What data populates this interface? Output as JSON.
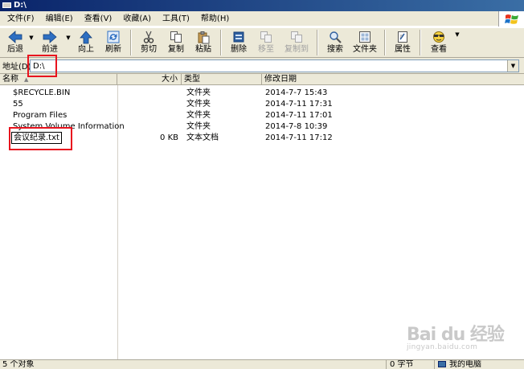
{
  "window": {
    "title": "D:\\"
  },
  "menu": [
    "文件(F)",
    "编辑(E)",
    "查看(V)",
    "收藏(A)",
    "工具(T)",
    "帮助(H)"
  ],
  "toolbar": {
    "back": "后退",
    "forward": "前进",
    "up": "向上",
    "refresh": "刷新",
    "cut": "剪切",
    "copy": "复制",
    "paste": "粘贴",
    "delete": "删除",
    "move_to": "移至",
    "copy_to": "复制到",
    "search": "搜索",
    "folders": "文件夹",
    "properties": "属性",
    "view": "查看"
  },
  "address": {
    "label": "地址(D)",
    "value": "D:\\"
  },
  "columns": {
    "name": "名称",
    "size": "大小",
    "type": "类型",
    "modified": "修改日期"
  },
  "files": [
    {
      "name": "$RECYCLE.BIN",
      "size": "",
      "type": "文件夹",
      "modified": "2014-7-7 15:43"
    },
    {
      "name": "55",
      "size": "",
      "type": "文件夹",
      "modified": "2014-7-11 17:31"
    },
    {
      "name": "Program Files",
      "size": "",
      "type": "文件夹",
      "modified": "2014-7-11 17:01"
    },
    {
      "name": "System Volume Information",
      "size": "",
      "type": "文件夹",
      "modified": "2014-7-8 10:39"
    },
    {
      "name": "会议纪录.txt",
      "size": "0 KB",
      "type": "文本文档",
      "modified": "2014-7-11 17:12"
    }
  ],
  "status": {
    "count": "5 个对象",
    "size": "0 字节",
    "location": "我的电脑"
  },
  "watermark": {
    "main": "Bai du 经验",
    "sub": "jingyan.baidu.com"
  },
  "colors": {
    "highlight": "#e8131e",
    "chrome": "#ece9d8",
    "titlebar": "#0a246a"
  }
}
